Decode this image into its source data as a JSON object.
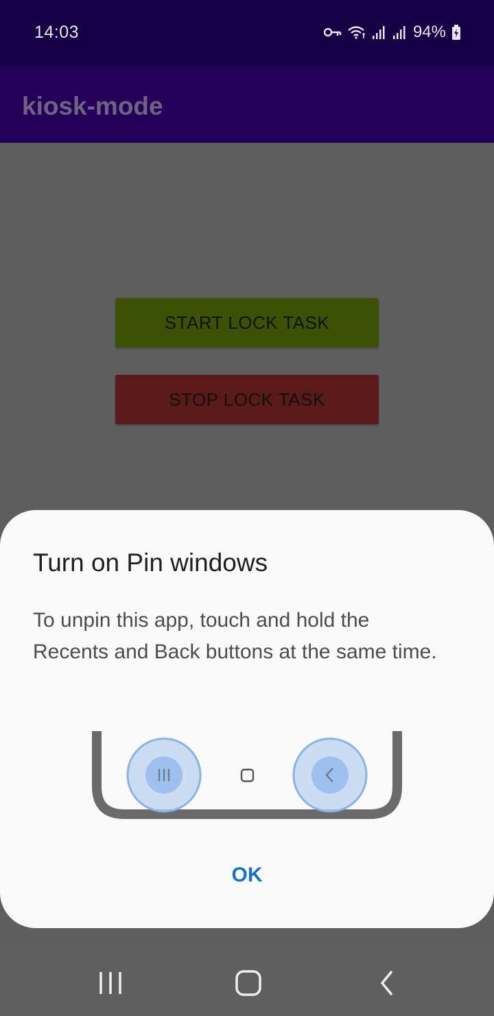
{
  "status_bar": {
    "time": "14:03",
    "battery": "94%",
    "icons": [
      "key-icon",
      "wifi-icon",
      "signal-icon",
      "signal-icon",
      "battery-charging-icon"
    ]
  },
  "app": {
    "title": "kiosk-mode"
  },
  "buttons": {
    "start": "START LOCK TASK",
    "stop": "STOP LOCK TASK"
  },
  "dialog": {
    "title": "Turn on Pin windows",
    "body": "To unpin this app, touch and hold the Recents and Back buttons at the same time.",
    "ok": "OK",
    "illustration_icons": [
      "recents-icon",
      "home-icon",
      "back-icon"
    ]
  },
  "navigation": {
    "icons": [
      "recents-icon",
      "home-icon",
      "back-icon"
    ]
  },
  "colors": {
    "status_bar": "#160045",
    "app_bar": "#25005a",
    "start_button": "#3d5104",
    "stop_button": "#5a1a1a",
    "dialog_accent": "#1873c7"
  }
}
